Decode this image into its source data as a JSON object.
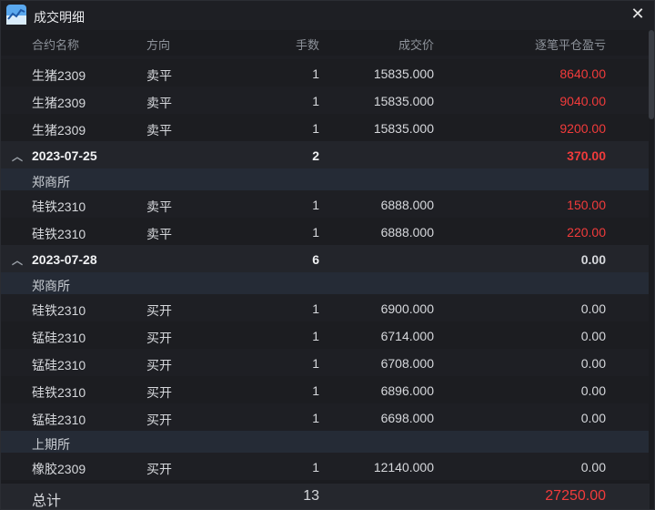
{
  "window": {
    "title": "成交明细"
  },
  "header": {
    "name": "合约名称",
    "direction": "方向",
    "quantity": "手数",
    "price": "成交价",
    "pnl": "逐笔平仓盈亏"
  },
  "rows": [
    {
      "kind": "trade",
      "name": "生猪2309",
      "direction": "卖平",
      "quantity": "1",
      "price": "15835.000",
      "pnl": "8640.00",
      "pnl_state": "pos"
    },
    {
      "kind": "trade",
      "name": "生猪2309",
      "direction": "卖平",
      "quantity": "1",
      "price": "15835.000",
      "pnl": "9040.00",
      "pnl_state": "pos"
    },
    {
      "kind": "trade",
      "name": "生猪2309",
      "direction": "卖平",
      "quantity": "1",
      "price": "15835.000",
      "pnl": "9200.00",
      "pnl_state": "pos"
    },
    {
      "kind": "date",
      "date": "2023-07-25",
      "quantity": "2",
      "pnl": "370.00",
      "pnl_state": "pos"
    },
    {
      "kind": "exchange",
      "name": "郑商所"
    },
    {
      "kind": "trade",
      "name": "硅铁2310",
      "direction": "卖平",
      "quantity": "1",
      "price": "6888.000",
      "pnl": "150.00",
      "pnl_state": "pos"
    },
    {
      "kind": "trade",
      "name": "硅铁2310",
      "direction": "卖平",
      "quantity": "1",
      "price": "6888.000",
      "pnl": "220.00",
      "pnl_state": "pos"
    },
    {
      "kind": "date",
      "date": "2023-07-28",
      "quantity": "6",
      "pnl": "0.00",
      "pnl_state": "zero"
    },
    {
      "kind": "exchange",
      "name": "郑商所"
    },
    {
      "kind": "trade",
      "name": "硅铁2310",
      "direction": "买开",
      "quantity": "1",
      "price": "6900.000",
      "pnl": "0.00",
      "pnl_state": "zero"
    },
    {
      "kind": "trade",
      "name": "锰硅2310",
      "direction": "买开",
      "quantity": "1",
      "price": "6714.000",
      "pnl": "0.00",
      "pnl_state": "zero"
    },
    {
      "kind": "trade",
      "name": "锰硅2310",
      "direction": "买开",
      "quantity": "1",
      "price": "6708.000",
      "pnl": "0.00",
      "pnl_state": "zero"
    },
    {
      "kind": "trade",
      "name": "硅铁2310",
      "direction": "买开",
      "quantity": "1",
      "price": "6896.000",
      "pnl": "0.00",
      "pnl_state": "zero"
    },
    {
      "kind": "trade",
      "name": "锰硅2310",
      "direction": "买开",
      "quantity": "1",
      "price": "6698.000",
      "pnl": "0.00",
      "pnl_state": "zero"
    },
    {
      "kind": "exchange",
      "name": "上期所"
    },
    {
      "kind": "trade",
      "name": "橡胶2309",
      "direction": "买开",
      "quantity": "1",
      "price": "12140.000",
      "pnl": "0.00",
      "pnl_state": "zero"
    }
  ],
  "footer": {
    "label": "总计",
    "quantity": "13",
    "pnl": "27250.00"
  },
  "colors": {
    "positive": "#f23b3b",
    "neutral": "#d6d8dc",
    "exchange_bg": "#252b36"
  },
  "icons": {
    "app": "chart-app-icon",
    "close": "close-icon",
    "chevron": "chevron-up-icon"
  }
}
